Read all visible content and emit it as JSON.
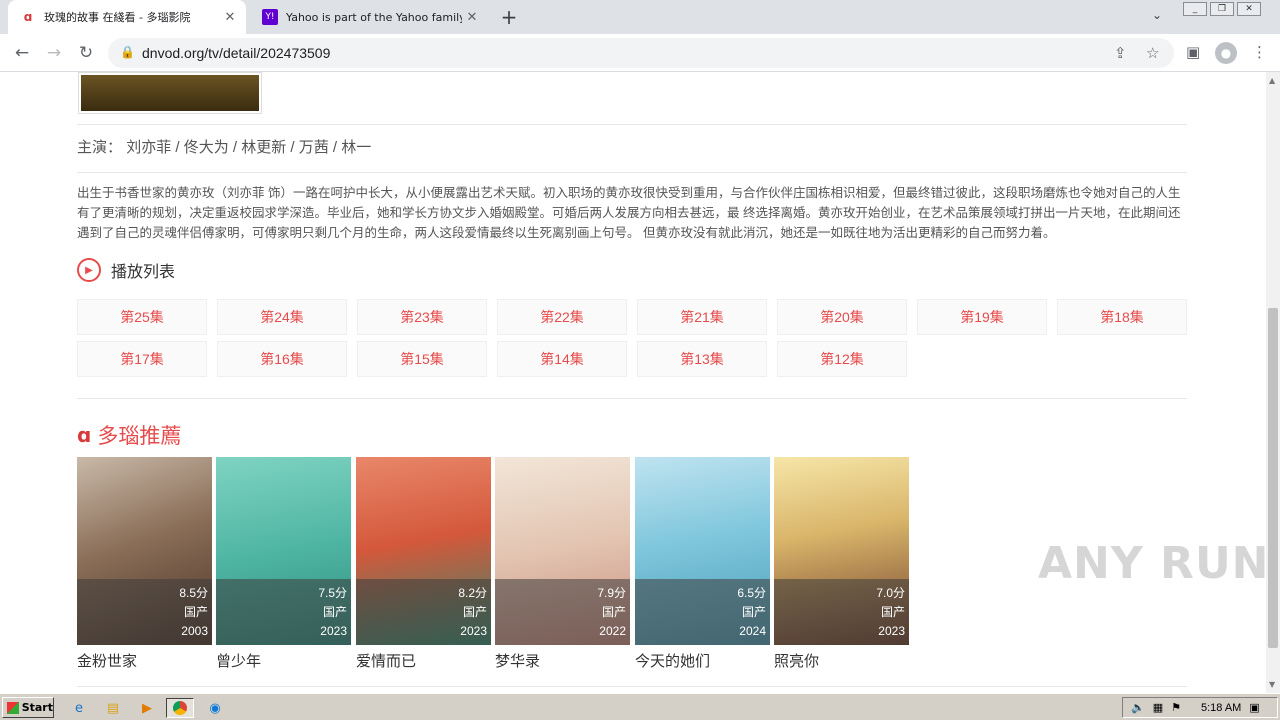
{
  "browser": {
    "tabs": [
      {
        "title": "玫瑰的故事 在綫看 - 多瑙影院",
        "active": true
      },
      {
        "title": "Yahoo is part of the Yahoo family of",
        "active": false
      }
    ],
    "url": "dnvod.org/tv/detail/202473509"
  },
  "detail": {
    "cast_label": "主演：",
    "cast": "刘亦菲 / 佟大为 / 林更新 / 万茜 / 林一",
    "description": "出生于书香世家的黄亦玫（刘亦菲 饰）一路在呵护中长大，从小便展露出艺术天赋。初入职场的黄亦玫很快受到重用，与合作伙伴庄国栋相识相爱，但最终错过彼此，这段职场磨炼也令她对自己的人生有了更清晰的规划，决定重返校园求学深造。毕业后，她和学长方协文步入婚姻殿堂。可婚后两人发展方向相去甚远，最 终选择离婚。黄亦玫开始创业，在艺术品策展领域打拼出一片天地，在此期间还遇到了自己的灵魂伴侣傅家明，可傅家明只剩几个月的生命，两人这段爱情最终以生死离别画上句号。 但黄亦玫没有就此消沉，她还是一如既往地为活出更精彩的自己而努力着。"
  },
  "playlist": {
    "title": "播放列表",
    "episodes": [
      "第25集",
      "第24集",
      "第23集",
      "第22集",
      "第21集",
      "第20集",
      "第19集",
      "第18集",
      "第17集",
      "第16集",
      "第15集",
      "第14集",
      "第13集",
      "第12集"
    ]
  },
  "recommend": {
    "title": "多瑙推薦",
    "items": [
      {
        "name": "金粉世家",
        "score": "8.5分",
        "region": "国产",
        "year": "2003"
      },
      {
        "name": "曾少年",
        "score": "7.5分",
        "region": "国产",
        "year": "2023"
      },
      {
        "name": "爱情而已",
        "score": "8.2分",
        "region": "国产",
        "year": "2023"
      },
      {
        "name": "梦华录",
        "score": "7.9分",
        "region": "国产",
        "year": "2022"
      },
      {
        "name": "今天的她们",
        "score": "6.5分",
        "region": "国产",
        "year": "2024"
      },
      {
        "name": "照亮你",
        "score": "7.0分",
        "region": "国产",
        "year": "2023"
      }
    ]
  },
  "watermark": "ANY RUN",
  "taskbar": {
    "start": "Start",
    "clock": "5:18 AM"
  },
  "colors": {
    "accent": "#e74c4c",
    "taskbar": "#d4d0c8"
  }
}
